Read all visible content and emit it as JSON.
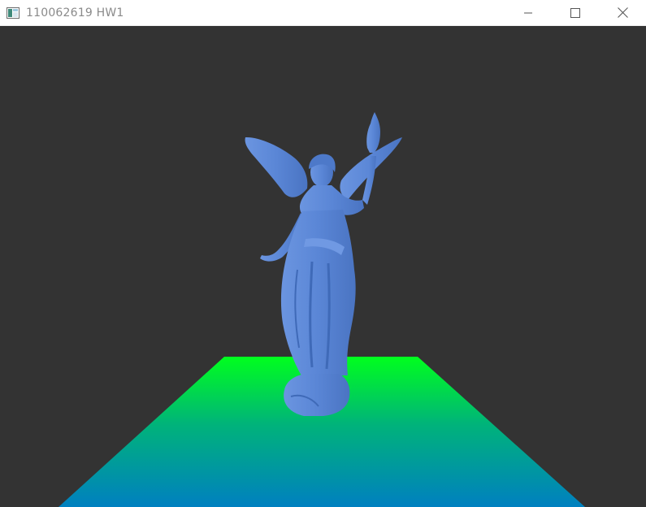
{
  "window": {
    "title": "110062619 HW1",
    "app_icon": "window-app-icon",
    "controls": {
      "minimize_icon": "minimize-icon",
      "maximize_icon": "maximize-icon",
      "close_icon": "close-icon"
    }
  },
  "scene": {
    "background_color": "#333333",
    "model": "angel-statue",
    "model_color": "#5a86d6",
    "floor": {
      "shape": "trapezoid-plane",
      "gradient_top_color": "#00ff1e",
      "gradient_bottom_color": "#0080c0"
    }
  }
}
